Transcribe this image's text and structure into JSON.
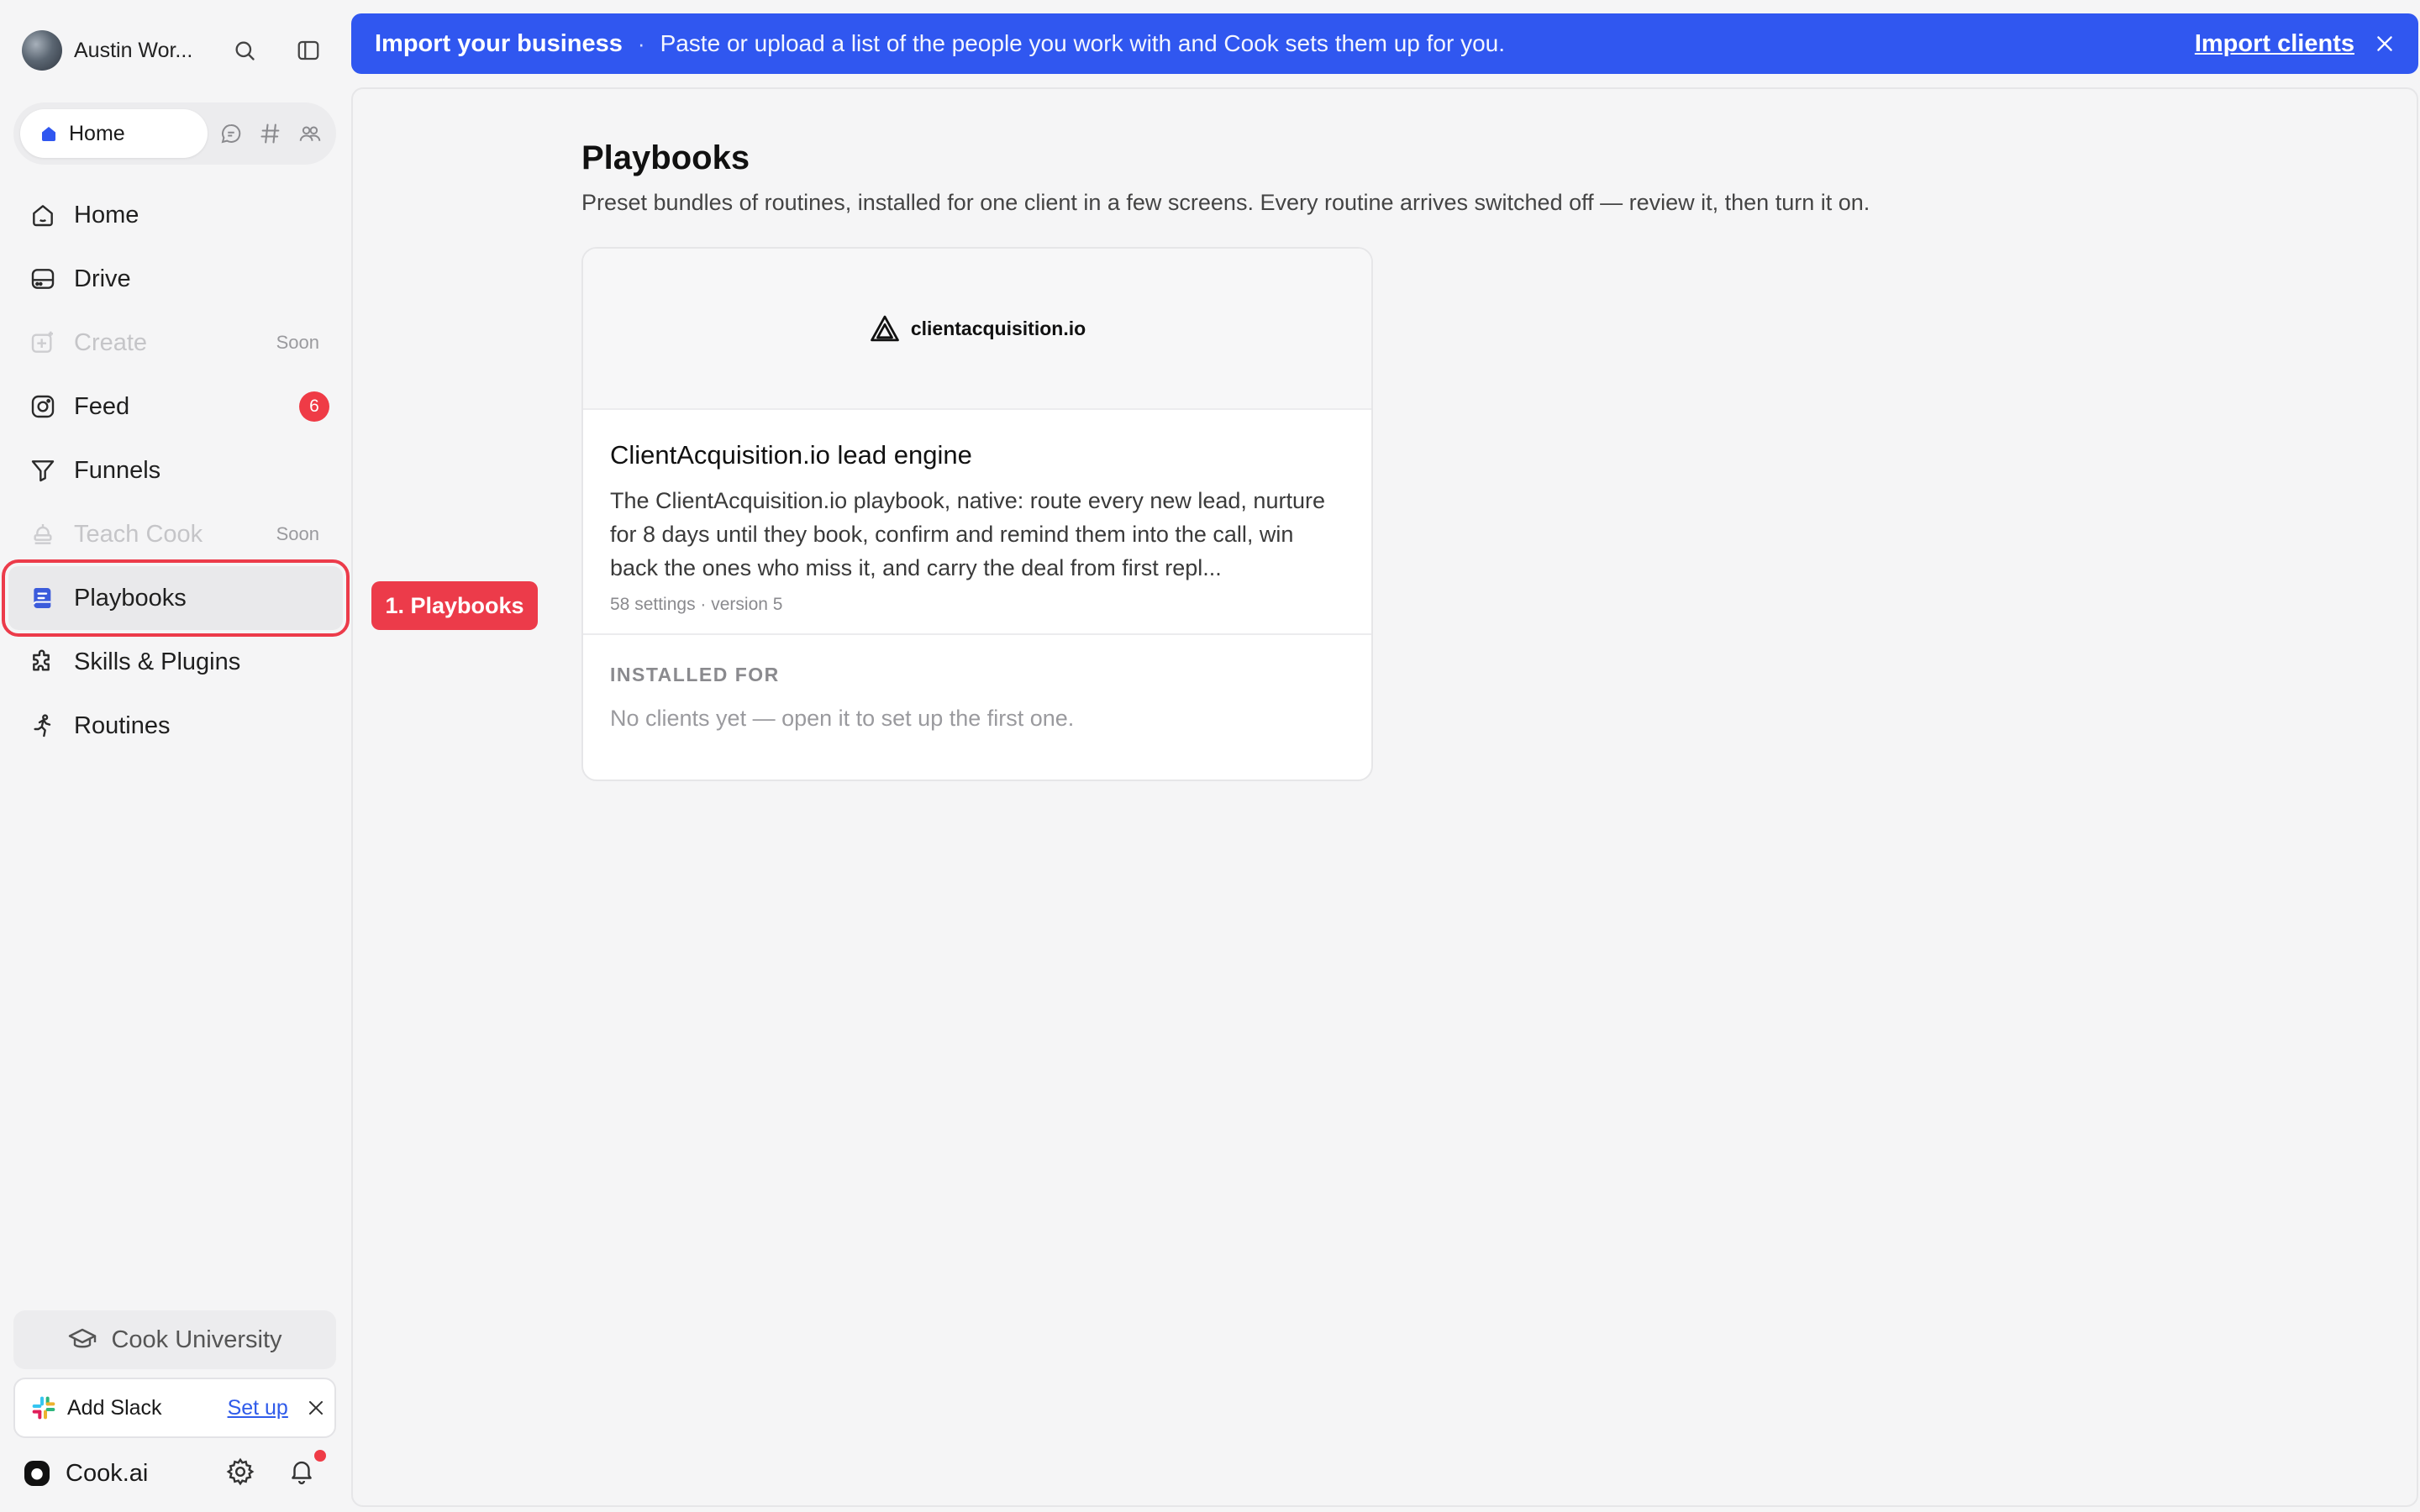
{
  "user": {
    "name": "Austin Wor..."
  },
  "switcher": {
    "home_label": "Home"
  },
  "nav": {
    "items": [
      {
        "label": "Home",
        "icon": "home-icon"
      },
      {
        "label": "Drive",
        "icon": "drive-icon"
      },
      {
        "label": "Create",
        "icon": "create-icon",
        "soon": "Soon"
      },
      {
        "label": "Feed",
        "icon": "feed-icon",
        "badge": "6"
      },
      {
        "label": "Funnels",
        "icon": "funnel-icon"
      },
      {
        "label": "Teach Cook",
        "icon": "teach-icon",
        "soon": "Soon"
      },
      {
        "label": "Playbooks",
        "icon": "playbook-icon"
      },
      {
        "label": "Skills & Plugins",
        "icon": "puzzle-icon"
      },
      {
        "label": "Routines",
        "icon": "runner-icon"
      }
    ]
  },
  "university": {
    "label": "Cook University"
  },
  "slack": {
    "label": "Add Slack",
    "setup": "Set up"
  },
  "footer": {
    "brand": "Cook.ai"
  },
  "banner": {
    "title": "Import your business",
    "separator": "·",
    "text": "Paste or upload a list of the people you work with and Cook sets them up for you.",
    "link": "Import clients"
  },
  "page": {
    "title": "Playbooks",
    "subtitle": "Preset bundles of routines, installed for one client in a few screens. Every routine arrives switched off — review it, then turn it on."
  },
  "card": {
    "logo_text": "clientacquisition.io",
    "title": "ClientAcquisition.io lead engine",
    "description": "The ClientAcquisition.io playbook, native: route every new lead, nurture for 8 days until they book, confirm and remind them into the call, win back the ones who miss it, and carry the deal from first repl...",
    "meta": "58 settings · version 5",
    "installed_heading": "INSTALLED FOR",
    "installed_empty": "No clients yet — open it to set up the first one."
  },
  "annotation": {
    "label": "1. Playbooks"
  },
  "colors": {
    "accent": "#3057f0",
    "highlight": "#ec3b4a",
    "badge": "#ef3b46",
    "link": "#2f5bea"
  }
}
